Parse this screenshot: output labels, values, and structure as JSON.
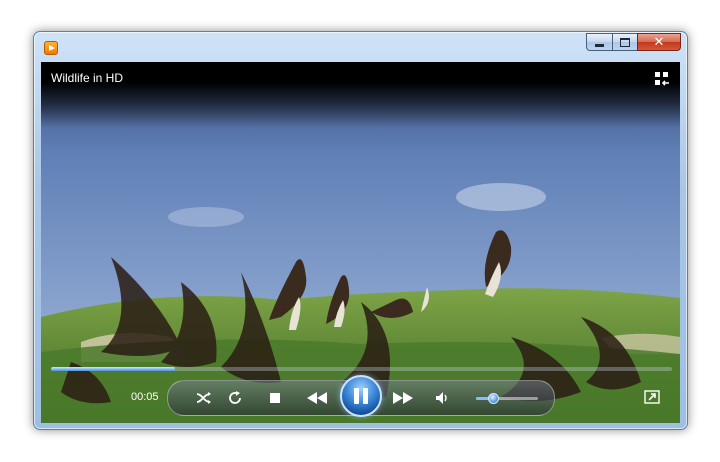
{
  "window": {
    "title": "Wildlife in HD",
    "icon": "media-player-icon",
    "caption_buttons": [
      "minimize",
      "maximize",
      "close"
    ]
  },
  "player": {
    "elapsed": "00:05",
    "progress_fraction": 0.2,
    "volume_fraction": 0.28,
    "state": "playing"
  },
  "colors": {
    "accent": "#3a86d6",
    "sky": "#7f9fd0",
    "grass": "#5d8a2e",
    "window_frame": "#a9c6e6",
    "close_button": "#c1391c"
  },
  "icons": {
    "switch_to_library": "switch-to-library-icon",
    "shuffle": "shuffle-icon",
    "repeat": "repeat-icon",
    "stop": "stop-icon",
    "previous": "previous-icon",
    "pause": "pause-icon",
    "next": "next-icon",
    "mute": "speaker-icon",
    "fullscreen": "fullscreen-icon"
  }
}
